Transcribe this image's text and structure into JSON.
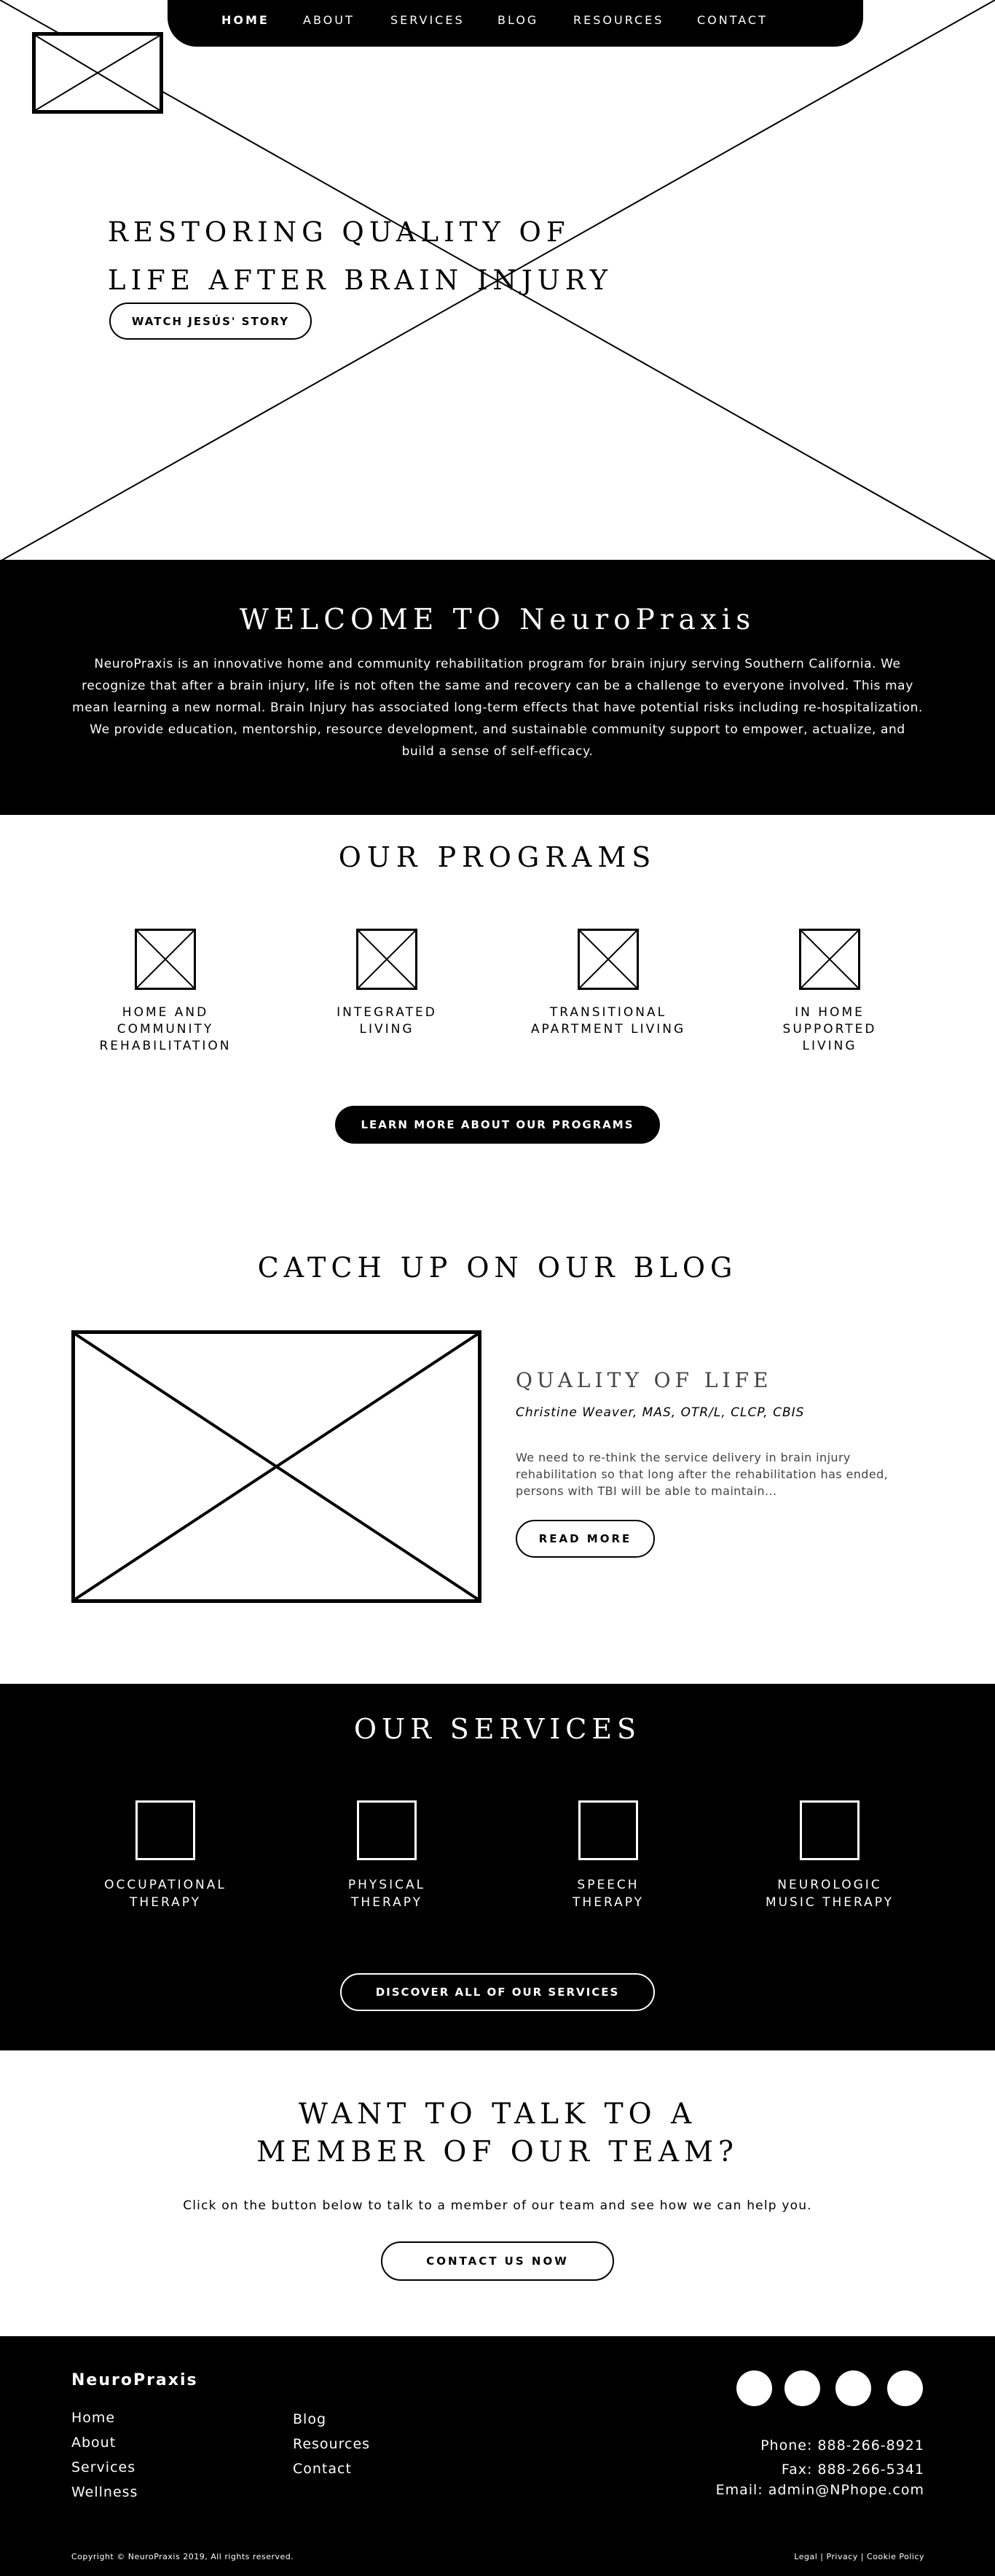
{
  "nav": {
    "items": [
      "HOME",
      "ABOUT",
      "SERVICES",
      "BLOG",
      "RESOURCES",
      "CONTACT"
    ]
  },
  "hero": {
    "title_line1": "RESTORING QUALITY OF",
    "title_line2": "LIFE AFTER BRAIN INJURY",
    "button_label": "WATCH JESÚS' STORY"
  },
  "welcome": {
    "title": "WELCOME TO NeuroPraxis",
    "body": "NeuroPraxis is an innovative home and community rehabilitation program for brain injury serving Southern California. We recognize that after a brain injury, life is not often the same and recovery can be a challenge to everyone involved. This may mean learning a new normal. Brain Injury has associated long-term effects that have potential risks including re-hospitalization. We provide education, mentorship, resource development, and sustainable community support to empower, actualize, and build a sense of self-efficacy."
  },
  "programs": {
    "title": "OUR PROGRAMS",
    "items": [
      {
        "line1": "HOME AND",
        "line2": "COMMUNITY",
        "line3": "REHABILITATION"
      },
      {
        "line1": "INTEGRATED",
        "line2": "LIVING",
        "line3": ""
      },
      {
        "line1": "TRANSITIONAL",
        "line2": "APARTMENT LIVING",
        "line3": ""
      },
      {
        "line1": "IN HOME",
        "line2": "SUPPORTED",
        "line3": "LIVING"
      }
    ],
    "button_label": "LEARN MORE ABOUT OUR PROGRAMS"
  },
  "blog": {
    "title": "CATCH UP ON OUR BLOG",
    "post_title": "QUALITY OF LIFE",
    "author": "Christine Weaver, MAS, OTR/L, CLCP, CBIS",
    "excerpt": "We need to re-think the service delivery in brain injury rehabilitation so that long after the rehabilitation has ended, persons with TBI will be able to maintain...",
    "button_label": "READ MORE"
  },
  "services": {
    "title": "OUR SERVICES",
    "items": [
      {
        "line1": "OCCUPATIONAL",
        "line2": "THERAPY"
      },
      {
        "line1": "PHYSICAL",
        "line2": "THERAPY"
      },
      {
        "line1": "SPEECH",
        "line2": "THERAPY"
      },
      {
        "line1": "NEUROLOGIC",
        "line2": "MUSIC THERAPY"
      }
    ],
    "button_label": "DISCOVER ALL OF OUR SERVICES"
  },
  "cta": {
    "title_line1": "WANT TO TALK TO A",
    "title_line2": "MEMBER OF OUR TEAM?",
    "text": "Click on the button below to talk to a member of our team and see how we can help you.",
    "button_label": "CONTACT US NOW"
  },
  "footer": {
    "brand": "NeuroPraxis",
    "col1": [
      "Home",
      "About",
      "Services",
      "Wellness"
    ],
    "col2": [
      "Blog",
      "Resources",
      "Contact"
    ],
    "phone": "Phone: 888-266-8921",
    "fax": "Fax: 888-266-5341",
    "email": "Email: admin@NPhope.com",
    "copyright": "Copyright © NeuroPraxis 2019, All rights reserved.",
    "legal": "Legal",
    "privacy": "Privacy",
    "cookie": "Cookie Policy",
    "separator": "|"
  }
}
